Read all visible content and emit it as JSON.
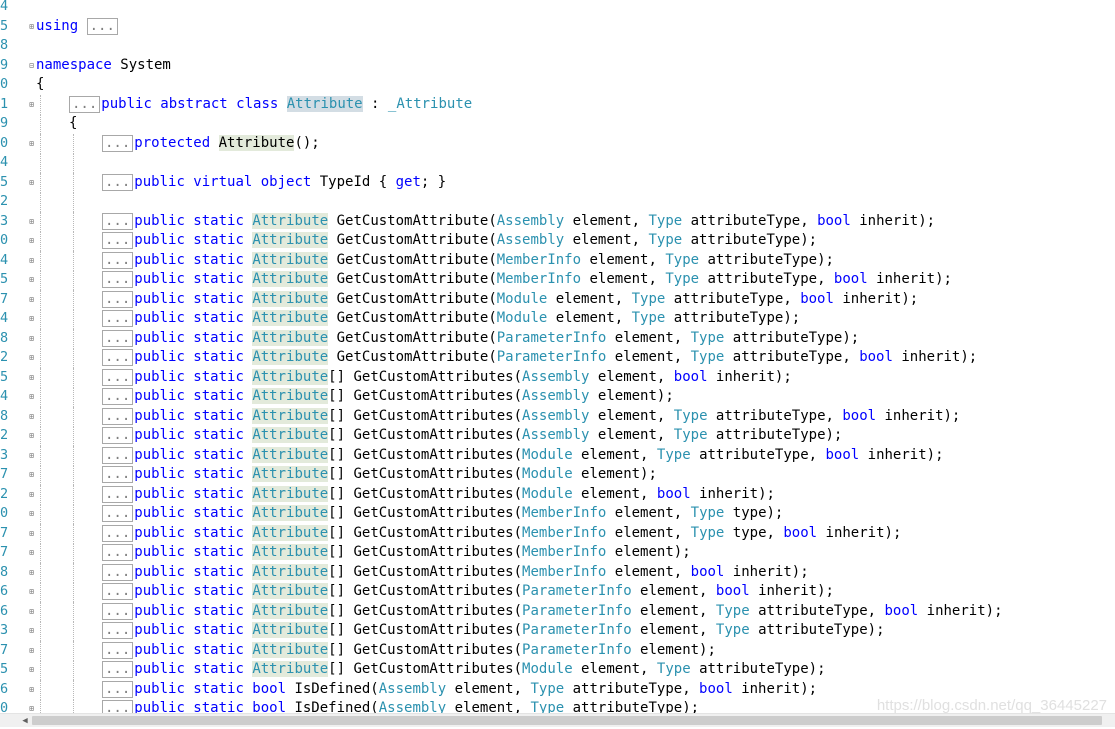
{
  "watermark": "https://blog.csdn.net/qq_36445227",
  "icons": {
    "fold": "plus-box-icon",
    "unfold": "minus-box-icon",
    "scroll": "arrow-left-icon"
  },
  "colors": {
    "keyword": "#0000ff",
    "type": "#2b91af",
    "highlight": "#e3eadb",
    "selection": "#d3dde4"
  },
  "lines": [
    {
      "n": "4",
      "fold": "",
      "indent": 0,
      "tokens": []
    },
    {
      "n": "5",
      "fold": "plus",
      "indent": 0,
      "tokens": [
        [
          "kw",
          "using"
        ],
        [
          "t",
          " "
        ],
        [
          "box",
          "..."
        ]
      ]
    },
    {
      "n": "8",
      "fold": "",
      "indent": 0,
      "tokens": []
    },
    {
      "n": "9",
      "fold": "minus",
      "indent": 0,
      "tokens": [
        [
          "kw",
          "namespace"
        ],
        [
          "t",
          " System"
        ]
      ]
    },
    {
      "n": "0",
      "fold": "",
      "indent": 0,
      "tokens": [
        [
          "t",
          "{"
        ]
      ]
    },
    {
      "n": "1",
      "fold": "plus",
      "indent": 1,
      "tokens": [
        [
          "box",
          "..."
        ],
        [
          "kw",
          "public abstract class"
        ],
        [
          "t",
          " "
        ],
        [
          "hl2",
          "Attribute"
        ],
        [
          "t",
          " : "
        ],
        [
          "ty",
          "_Attribute"
        ]
      ]
    },
    {
      "n": "9",
      "fold": "",
      "indent": 1,
      "tokens": [
        [
          "t",
          "{"
        ]
      ]
    },
    {
      "n": "0",
      "fold": "plus",
      "indent": 2,
      "tokens": [
        [
          "box",
          "..."
        ],
        [
          "kw",
          "protected"
        ],
        [
          "t",
          " "
        ],
        [
          "hl",
          "Attribute"
        ],
        [
          "t",
          "();"
        ]
      ]
    },
    {
      "n": "4",
      "fold": "",
      "indent": 2,
      "tokens": []
    },
    {
      "n": "5",
      "fold": "plus",
      "indent": 2,
      "tokens": [
        [
          "box",
          "..."
        ],
        [
          "kw",
          "public virtual object"
        ],
        [
          "t",
          " TypeId { "
        ],
        [
          "kw",
          "get"
        ],
        [
          "t",
          "; }"
        ]
      ]
    },
    {
      "n": "2",
      "fold": "",
      "indent": 2,
      "tokens": []
    },
    {
      "n": "3",
      "fold": "plus",
      "indent": 2,
      "tokens": [
        [
          "box",
          "..."
        ],
        [
          "kw",
          "public static"
        ],
        [
          "t",
          " "
        ],
        [
          "hlty",
          "Attribute"
        ],
        [
          "t",
          " GetCustomAttribute("
        ],
        [
          "ty",
          "Assembly"
        ],
        [
          "t",
          " element, "
        ],
        [
          "ty",
          "Type"
        ],
        [
          "t",
          " attributeType, "
        ],
        [
          "kw",
          "bool"
        ],
        [
          "t",
          " inherit);"
        ]
      ]
    },
    {
      "n": "0",
      "fold": "plus",
      "indent": 2,
      "tokens": [
        [
          "box",
          "..."
        ],
        [
          "kw",
          "public static"
        ],
        [
          "t",
          " "
        ],
        [
          "hlty",
          "Attribute"
        ],
        [
          "t",
          " GetCustomAttribute("
        ],
        [
          "ty",
          "Assembly"
        ],
        [
          "t",
          " element, "
        ],
        [
          "ty",
          "Type"
        ],
        [
          "t",
          " attributeType);"
        ]
      ]
    },
    {
      "n": "4",
      "fold": "plus",
      "indent": 2,
      "tokens": [
        [
          "box",
          "..."
        ],
        [
          "kw",
          "public static"
        ],
        [
          "t",
          " "
        ],
        [
          "hlty",
          "Attribute"
        ],
        [
          "t",
          " GetCustomAttribute("
        ],
        [
          "ty",
          "MemberInfo"
        ],
        [
          "t",
          " element, "
        ],
        [
          "ty",
          "Type"
        ],
        [
          "t",
          " attributeType);"
        ]
      ]
    },
    {
      "n": "5",
      "fold": "plus",
      "indent": 2,
      "tokens": [
        [
          "box",
          "..."
        ],
        [
          "kw",
          "public static"
        ],
        [
          "t",
          " "
        ],
        [
          "hlty",
          "Attribute"
        ],
        [
          "t",
          " GetCustomAttribute("
        ],
        [
          "ty",
          "MemberInfo"
        ],
        [
          "t",
          " element, "
        ],
        [
          "ty",
          "Type"
        ],
        [
          "t",
          " attributeType, "
        ],
        [
          "kw",
          "bool"
        ],
        [
          "t",
          " inherit);"
        ]
      ]
    },
    {
      "n": "7",
      "fold": "plus",
      "indent": 2,
      "tokens": [
        [
          "box",
          "..."
        ],
        [
          "kw",
          "public static"
        ],
        [
          "t",
          " "
        ],
        [
          "hlty",
          "Attribute"
        ],
        [
          "t",
          " GetCustomAttribute("
        ],
        [
          "ty",
          "Module"
        ],
        [
          "t",
          " element, "
        ],
        [
          "ty",
          "Type"
        ],
        [
          "t",
          " attributeType, "
        ],
        [
          "kw",
          "bool"
        ],
        [
          "t",
          " inherit);"
        ]
      ]
    },
    {
      "n": "4",
      "fold": "plus",
      "indent": 2,
      "tokens": [
        [
          "box",
          "..."
        ],
        [
          "kw",
          "public static"
        ],
        [
          "t",
          " "
        ],
        [
          "hlty",
          "Attribute"
        ],
        [
          "t",
          " GetCustomAttribute("
        ],
        [
          "ty",
          "Module"
        ],
        [
          "t",
          " element, "
        ],
        [
          "ty",
          "Type"
        ],
        [
          "t",
          " attributeType);"
        ]
      ]
    },
    {
      "n": "8",
      "fold": "plus",
      "indent": 2,
      "tokens": [
        [
          "box",
          "..."
        ],
        [
          "kw",
          "public static"
        ],
        [
          "t",
          " "
        ],
        [
          "hlty",
          "Attribute"
        ],
        [
          "t",
          " GetCustomAttribute("
        ],
        [
          "ty",
          "ParameterInfo"
        ],
        [
          "t",
          " element, "
        ],
        [
          "ty",
          "Type"
        ],
        [
          "t",
          " attributeType);"
        ]
      ]
    },
    {
      "n": "2",
      "fold": "plus",
      "indent": 2,
      "tokens": [
        [
          "box",
          "..."
        ],
        [
          "kw",
          "public static"
        ],
        [
          "t",
          " "
        ],
        [
          "hlty",
          "Attribute"
        ],
        [
          "t",
          " GetCustomAttribute("
        ],
        [
          "ty",
          "ParameterInfo"
        ],
        [
          "t",
          " element, "
        ],
        [
          "ty",
          "Type"
        ],
        [
          "t",
          " attributeType, "
        ],
        [
          "kw",
          "bool"
        ],
        [
          "t",
          " inherit);"
        ]
      ]
    },
    {
      "n": "5",
      "fold": "plus",
      "indent": 2,
      "tokens": [
        [
          "box",
          "..."
        ],
        [
          "kw",
          "public static"
        ],
        [
          "t",
          " "
        ],
        [
          "hlty",
          "Attribute"
        ],
        [
          "t",
          "[] GetCustomAttributes("
        ],
        [
          "ty",
          "Assembly"
        ],
        [
          "t",
          " element, "
        ],
        [
          "kw",
          "bool"
        ],
        [
          "t",
          " inherit);"
        ]
      ]
    },
    {
      "n": "4",
      "fold": "plus",
      "indent": 2,
      "tokens": [
        [
          "box",
          "..."
        ],
        [
          "kw",
          "public static"
        ],
        [
          "t",
          " "
        ],
        [
          "hlty",
          "Attribute"
        ],
        [
          "t",
          "[] GetCustomAttributes("
        ],
        [
          "ty",
          "Assembly"
        ],
        [
          "t",
          " element);"
        ]
      ]
    },
    {
      "n": "8",
      "fold": "plus",
      "indent": 2,
      "tokens": [
        [
          "box",
          "..."
        ],
        [
          "kw",
          "public static"
        ],
        [
          "t",
          " "
        ],
        [
          "hlty",
          "Attribute"
        ],
        [
          "t",
          "[] GetCustomAttributes("
        ],
        [
          "ty",
          "Assembly"
        ],
        [
          "t",
          " element, "
        ],
        [
          "ty",
          "Type"
        ],
        [
          "t",
          " attributeType, "
        ],
        [
          "kw",
          "bool"
        ],
        [
          "t",
          " inherit);"
        ]
      ]
    },
    {
      "n": "2",
      "fold": "plus",
      "indent": 2,
      "tokens": [
        [
          "box",
          "..."
        ],
        [
          "kw",
          "public static"
        ],
        [
          "t",
          " "
        ],
        [
          "hlty",
          "Attribute"
        ],
        [
          "t",
          "[] GetCustomAttributes("
        ],
        [
          "ty",
          "Assembly"
        ],
        [
          "t",
          " element, "
        ],
        [
          "ty",
          "Type"
        ],
        [
          "t",
          " attributeType);"
        ]
      ]
    },
    {
      "n": "3",
      "fold": "plus",
      "indent": 2,
      "tokens": [
        [
          "box",
          "..."
        ],
        [
          "kw",
          "public static"
        ],
        [
          "t",
          " "
        ],
        [
          "hlty",
          "Attribute"
        ],
        [
          "t",
          "[] GetCustomAttributes("
        ],
        [
          "ty",
          "Module"
        ],
        [
          "t",
          " element, "
        ],
        [
          "ty",
          "Type"
        ],
        [
          "t",
          " attributeType, "
        ],
        [
          "kw",
          "bool"
        ],
        [
          "t",
          " inherit);"
        ]
      ]
    },
    {
      "n": "7",
      "fold": "plus",
      "indent": 2,
      "tokens": [
        [
          "box",
          "..."
        ],
        [
          "kw",
          "public static"
        ],
        [
          "t",
          " "
        ],
        [
          "hlty",
          "Attribute"
        ],
        [
          "t",
          "[] GetCustomAttributes("
        ],
        [
          "ty",
          "Module"
        ],
        [
          "t",
          " element);"
        ]
      ]
    },
    {
      "n": "2",
      "fold": "plus",
      "indent": 2,
      "tokens": [
        [
          "box",
          "..."
        ],
        [
          "kw",
          "public static"
        ],
        [
          "t",
          " "
        ],
        [
          "hlty",
          "Attribute"
        ],
        [
          "t",
          "[] GetCustomAttributes("
        ],
        [
          "ty",
          "Module"
        ],
        [
          "t",
          " element, "
        ],
        [
          "kw",
          "bool"
        ],
        [
          "t",
          " inherit);"
        ]
      ]
    },
    {
      "n": "0",
      "fold": "plus",
      "indent": 2,
      "tokens": [
        [
          "box",
          "..."
        ],
        [
          "kw",
          "public static"
        ],
        [
          "t",
          " "
        ],
        [
          "hlty",
          "Attribute"
        ],
        [
          "t",
          "[] GetCustomAttributes("
        ],
        [
          "ty",
          "MemberInfo"
        ],
        [
          "t",
          " element, "
        ],
        [
          "ty",
          "Type"
        ],
        [
          "t",
          " type);"
        ]
      ]
    },
    {
      "n": "7",
      "fold": "plus",
      "indent": 2,
      "tokens": [
        [
          "box",
          "..."
        ],
        [
          "kw",
          "public static"
        ],
        [
          "t",
          " "
        ],
        [
          "hlty",
          "Attribute"
        ],
        [
          "t",
          "[] GetCustomAttributes("
        ],
        [
          "ty",
          "MemberInfo"
        ],
        [
          "t",
          " element, "
        ],
        [
          "ty",
          "Type"
        ],
        [
          "t",
          " type, "
        ],
        [
          "kw",
          "bool"
        ],
        [
          "t",
          " inherit);"
        ]
      ]
    },
    {
      "n": "7",
      "fold": "plus",
      "indent": 2,
      "tokens": [
        [
          "box",
          "..."
        ],
        [
          "kw",
          "public static"
        ],
        [
          "t",
          " "
        ],
        [
          "hlty",
          "Attribute"
        ],
        [
          "t",
          "[] GetCustomAttributes("
        ],
        [
          "ty",
          "MemberInfo"
        ],
        [
          "t",
          " element);"
        ]
      ]
    },
    {
      "n": "8",
      "fold": "plus",
      "indent": 2,
      "tokens": [
        [
          "box",
          "..."
        ],
        [
          "kw",
          "public static"
        ],
        [
          "t",
          " "
        ],
        [
          "hlty",
          "Attribute"
        ],
        [
          "t",
          "[] GetCustomAttributes("
        ],
        [
          "ty",
          "MemberInfo"
        ],
        [
          "t",
          " element, "
        ],
        [
          "kw",
          "bool"
        ],
        [
          "t",
          " inherit);"
        ]
      ]
    },
    {
      "n": "6",
      "fold": "plus",
      "indent": 2,
      "tokens": [
        [
          "box",
          "..."
        ],
        [
          "kw",
          "public static"
        ],
        [
          "t",
          " "
        ],
        [
          "hlty",
          "Attribute"
        ],
        [
          "t",
          "[] GetCustomAttributes("
        ],
        [
          "ty",
          "ParameterInfo"
        ],
        [
          "t",
          " element, "
        ],
        [
          "kw",
          "bool"
        ],
        [
          "t",
          " inherit);"
        ]
      ]
    },
    {
      "n": "6",
      "fold": "plus",
      "indent": 2,
      "tokens": [
        [
          "box",
          "..."
        ],
        [
          "kw",
          "public static"
        ],
        [
          "t",
          " "
        ],
        [
          "hlty",
          "Attribute"
        ],
        [
          "t",
          "[] GetCustomAttributes("
        ],
        [
          "ty",
          "ParameterInfo"
        ],
        [
          "t",
          " element, "
        ],
        [
          "ty",
          "Type"
        ],
        [
          "t",
          " attributeType, "
        ],
        [
          "kw",
          "bool"
        ],
        [
          "t",
          " inherit);"
        ]
      ]
    },
    {
      "n": "3",
      "fold": "plus",
      "indent": 2,
      "tokens": [
        [
          "box",
          "..."
        ],
        [
          "kw",
          "public static"
        ],
        [
          "t",
          " "
        ],
        [
          "hlty",
          "Attribute"
        ],
        [
          "t",
          "[] GetCustomAttributes("
        ],
        [
          "ty",
          "ParameterInfo"
        ],
        [
          "t",
          " element, "
        ],
        [
          "ty",
          "Type"
        ],
        [
          "t",
          " attributeType);"
        ]
      ]
    },
    {
      "n": "7",
      "fold": "plus",
      "indent": 2,
      "tokens": [
        [
          "box",
          "..."
        ],
        [
          "kw",
          "public static"
        ],
        [
          "t",
          " "
        ],
        [
          "hlty",
          "Attribute"
        ],
        [
          "t",
          "[] GetCustomAttributes("
        ],
        [
          "ty",
          "ParameterInfo"
        ],
        [
          "t",
          " element);"
        ]
      ]
    },
    {
      "n": "5",
      "fold": "plus",
      "indent": 2,
      "tokens": [
        [
          "box",
          "..."
        ],
        [
          "kw",
          "public static"
        ],
        [
          "t",
          " "
        ],
        [
          "hlty",
          "Attribute"
        ],
        [
          "t",
          "[] GetCustomAttributes("
        ],
        [
          "ty",
          "Module"
        ],
        [
          "t",
          " element, "
        ],
        [
          "ty",
          "Type"
        ],
        [
          "t",
          " attributeType);"
        ]
      ]
    },
    {
      "n": "6",
      "fold": "plus",
      "indent": 2,
      "tokens": [
        [
          "box",
          "..."
        ],
        [
          "kw",
          "public static bool"
        ],
        [
          "t",
          " IsDefined("
        ],
        [
          "ty",
          "Assembly"
        ],
        [
          "t",
          " element, "
        ],
        [
          "ty",
          "Type"
        ],
        [
          "t",
          " attributeType, "
        ],
        [
          "kw",
          "bool"
        ],
        [
          "t",
          " inherit);"
        ]
      ]
    },
    {
      "n": "0",
      "fold": "plus",
      "indent": 2,
      "tokens": [
        [
          "box",
          "..."
        ],
        [
          "kw",
          "public static bool"
        ],
        [
          "t",
          " IsDefined("
        ],
        [
          "ty",
          "Assembly"
        ],
        [
          "t",
          " element, "
        ],
        [
          "ty",
          "Type"
        ],
        [
          "t",
          " attributeType);"
        ]
      ]
    }
  ]
}
